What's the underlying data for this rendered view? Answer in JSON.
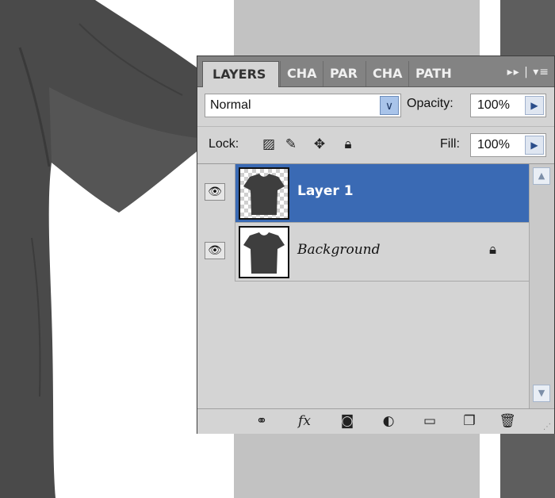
{
  "panel": {
    "tabs": [
      "LAYERS",
      "CHA",
      "PAR",
      "CHA",
      "PATH"
    ],
    "menu_glyphs": "▸▸ | ▾≡",
    "blend_mode": "Normal",
    "opacity_label": "Opacity:",
    "opacity_value": "100%",
    "lock_label": "Lock:",
    "fill_label": "Fill:",
    "fill_value": "100%",
    "layers": [
      {
        "name": "Layer 1",
        "visible": true,
        "selected": true
      },
      {
        "name": "Background",
        "visible": true,
        "selected": false,
        "locked": true
      }
    ],
    "footer_icons": [
      "link-icon",
      "fx-icon",
      "mask-icon",
      "adjustment-icon",
      "folder-icon",
      "new-layer-icon",
      "trash-icon"
    ],
    "footer_fx": "fx"
  },
  "colors": {
    "selection": "#3a6ab4",
    "panel_bg": "#d4d4d4",
    "tab_bar": "#838383",
    "shirt": "#4a4a4a"
  }
}
